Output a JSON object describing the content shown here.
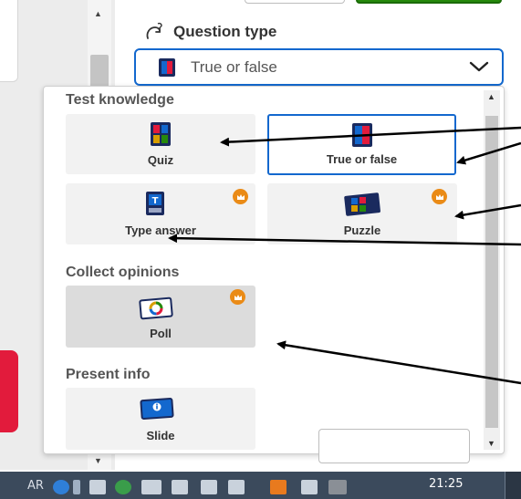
{
  "header": {
    "title": "Question type",
    "selected_value": "True or false"
  },
  "dropdown": {
    "sections": [
      {
        "label": "Test knowledge",
        "items": [
          {
            "label": "Quiz",
            "icon": "quiz-icon",
            "premium": false
          },
          {
            "label": "True or false",
            "icon": "true-false-icon",
            "premium": false,
            "selected": true
          },
          {
            "label": "Type answer",
            "icon": "type-answer-icon",
            "premium": true
          },
          {
            "label": "Puzzle",
            "icon": "puzzle-icon",
            "premium": true
          }
        ]
      },
      {
        "label": "Collect opinions",
        "items": [
          {
            "label": "Poll",
            "icon": "poll-icon",
            "premium": true
          }
        ]
      },
      {
        "label": "Present info",
        "items": [
          {
            "label": "Slide",
            "icon": "slide-icon",
            "premium": false
          }
        ]
      }
    ]
  },
  "taskbar": {
    "language": "AR",
    "time": "21:25"
  },
  "colors": {
    "accent_blue": "#1368ce",
    "premium_orange": "#ea8b17",
    "brand_red": "#e21b3c",
    "brand_green": "#26890c",
    "taskbar": "#3b4a5c"
  }
}
